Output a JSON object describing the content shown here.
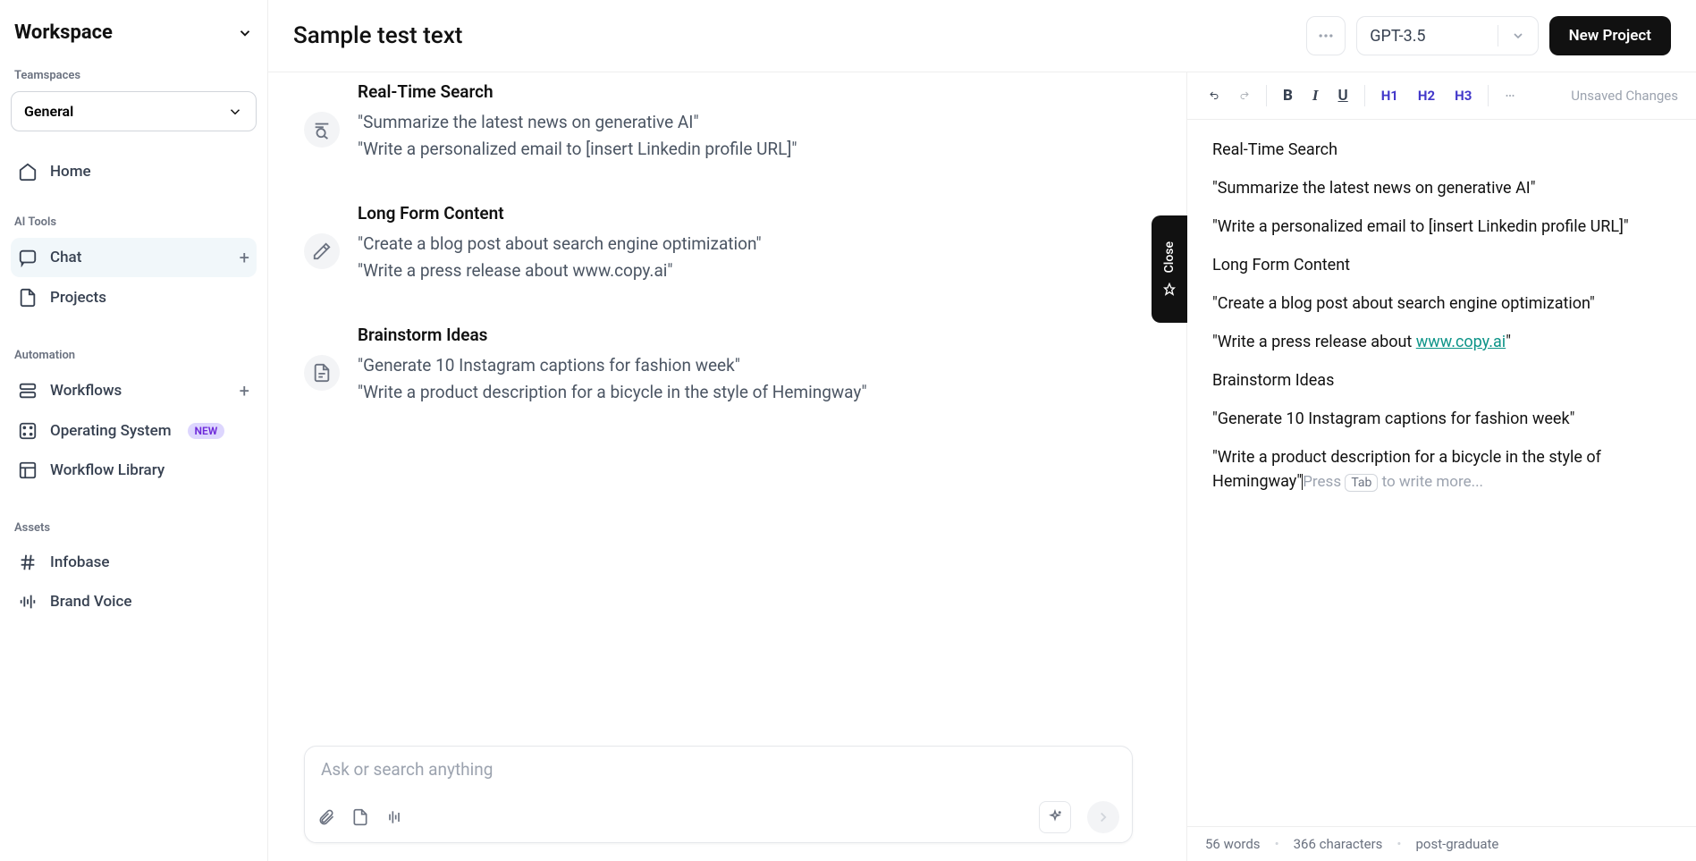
{
  "workspace": {
    "title": "Workspace"
  },
  "teamspaces": {
    "label": "Teamspaces",
    "selected": "General"
  },
  "nav": {
    "home": "Home",
    "ai_tools_label": "AI Tools",
    "chat": "Chat",
    "projects": "Projects",
    "automation_label": "Automation",
    "workflows": "Workflows",
    "operating_system": "Operating System",
    "os_badge": "NEW",
    "workflow_library": "Workflow Library",
    "assets_label": "Assets",
    "infobase": "Infobase",
    "brand_voice": "Brand Voice"
  },
  "topbar": {
    "title": "Sample test text",
    "model": "GPT-3.5",
    "new_project": "New Project"
  },
  "close_label": "Close",
  "suggestions": {
    "s1": {
      "title": "Real-Time Search",
      "line1": "\"Summarize the latest news on generative AI\"",
      "line2": "\"Write a personalized email to [insert Linkedin profile URL]\""
    },
    "s2": {
      "title": "Long Form Content",
      "line1": "\"Create a blog post about search engine optimization\"",
      "line2": "\"Write a press release about www.copy.ai\""
    },
    "s3": {
      "title": "Brainstorm Ideas",
      "line1": "\"Generate 10 Instagram captions for fashion week\"",
      "line2": "\"Write a product description for a bicycle in the style of Hemingway\""
    }
  },
  "input": {
    "placeholder": "Ask or search anything"
  },
  "editor": {
    "unsaved": "Unsaved Changes",
    "h1": "H1",
    "h2": "H2",
    "h3": "H3",
    "p1": "Real-Time Search",
    "p2": "\"Summarize the latest news on generative AI\"",
    "p3": "\"Write a personalized email to [insert Linkedin profile URL]\"",
    "p4": "Long Form Content",
    "p5": "\"Create a blog post about search engine optimization\"",
    "p6a": "\"Write a press release about ",
    "p6link": "www.copy.ai",
    "p6b": "\"",
    "p7": "Brainstorm Ideas",
    "p8": "\"Generate 10 Instagram captions for fashion week\"",
    "p9a": "\"Write a product description for a bicycle in the style of Hemingway\"",
    "hint_press": "Press ",
    "hint_tab": "Tab",
    "hint_rest": " to write more..."
  },
  "footer": {
    "words": "56 words",
    "chars": "366 characters",
    "level": "post-graduate"
  }
}
